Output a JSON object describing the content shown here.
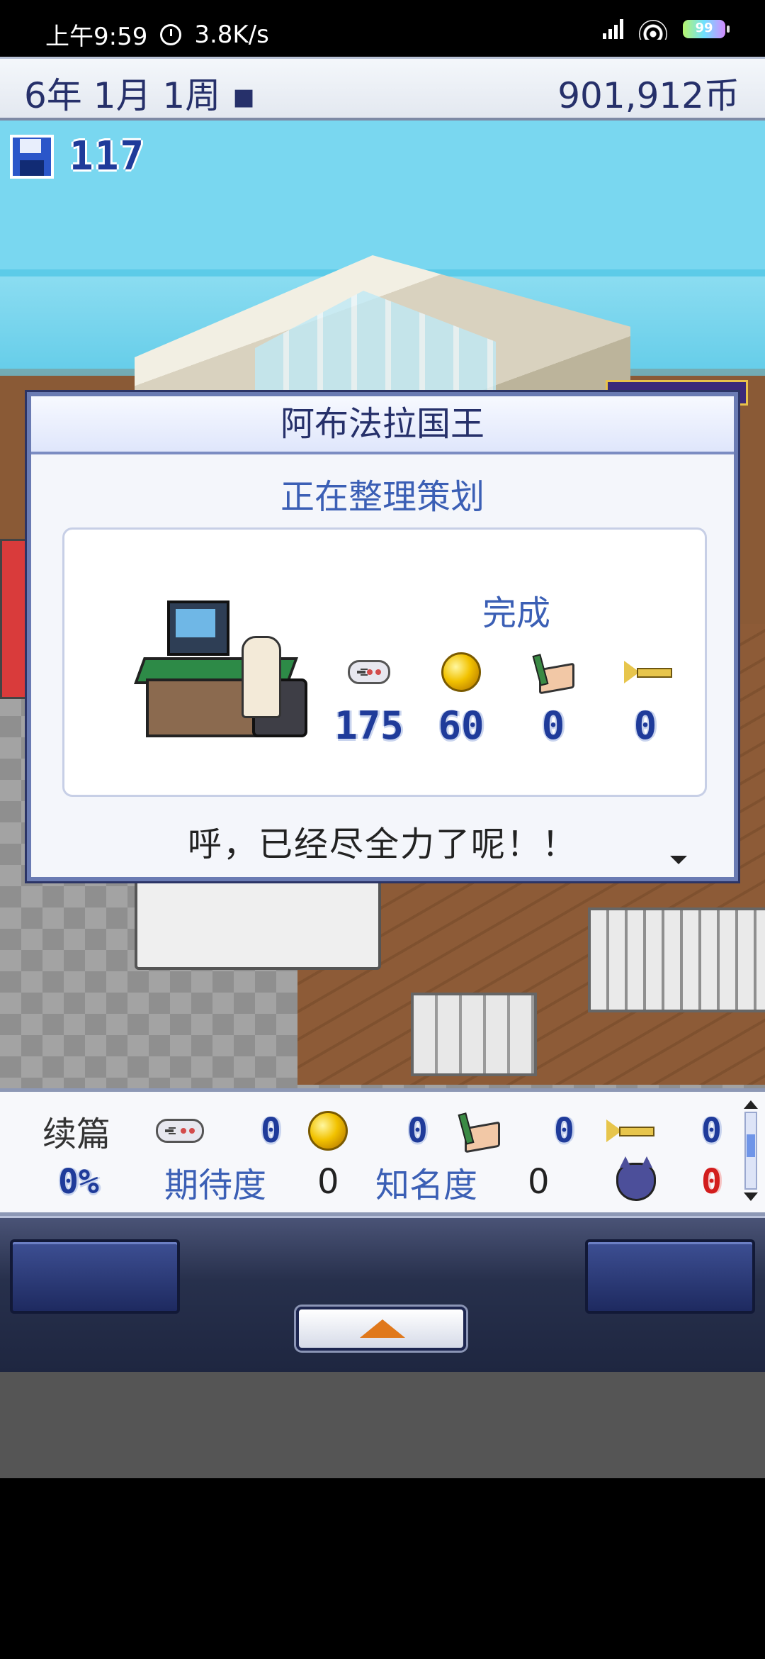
{
  "status_bar": {
    "time": "上午9:59",
    "speed": "3.8K/s",
    "battery": "99"
  },
  "header": {
    "date": "6年 1月 1周 ▪",
    "money": "901,912币"
  },
  "save": {
    "count": "117"
  },
  "dialog": {
    "title": "阿布法拉国王",
    "subtitle": "正在整理策划",
    "status": "完成",
    "stats": [
      {
        "icon": "gamepad-icon",
        "value": "175"
      },
      {
        "icon": "coin-icon",
        "value": "60"
      },
      {
        "icon": "paintbrush-icon",
        "value": "0"
      },
      {
        "icon": "trumpet-icon",
        "value": "0"
      }
    ],
    "message": "呼，已经尽全力了呢！！"
  },
  "bottom_bar": {
    "label_sequel": "续篇",
    "fun_value": "0",
    "creativity_value": "0",
    "graphics_value": "0",
    "sound_value": "0",
    "progress": "0%",
    "label_expectation": "期待度",
    "expectation_value": "0",
    "label_fame": "知名度",
    "fame_value": "0",
    "bug_value": "0"
  },
  "colors": {
    "accent_blue": "#3b5fb5",
    "number_navy": "#1f3b9a",
    "bug_red": "#d21d1d",
    "button_orange": "#e0781b"
  }
}
